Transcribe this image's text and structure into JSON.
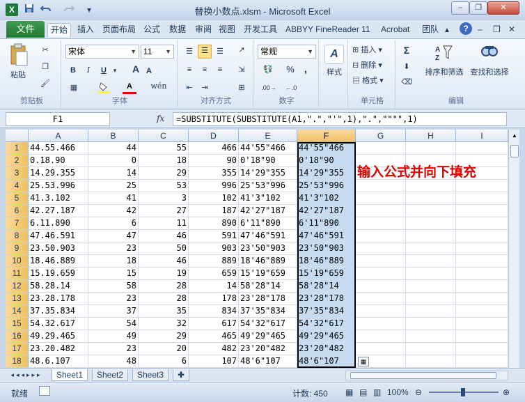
{
  "window": {
    "title": "替换小数点.xlsm - Microsoft Excel"
  },
  "quick_access": {
    "logo": "X",
    "save_icon": "save-icon",
    "undo_icon": "undo-icon",
    "redo_icon": "redo-icon"
  },
  "window_controls": {
    "minimize": "–",
    "restore": "❐",
    "close": "✕",
    "ribbon_min": "–",
    "ribbon_restore": "❐",
    "ribbon_close": "✕"
  },
  "tabs": [
    "文件",
    "开始",
    "插入",
    "页面布局",
    "公式",
    "数据",
    "审阅",
    "视图",
    "开发工具",
    "ABBYY FineReader 11",
    "Acrobat",
    "团队"
  ],
  "help_label": "?",
  "ribbon": {
    "clipboard": {
      "label": "剪贴板",
      "paste": "粘贴"
    },
    "font": {
      "label": "字体",
      "name": "宋体",
      "size": "11",
      "bold": "B",
      "italic": "I",
      "underline": "U",
      "grow": "A",
      "shrink": "A",
      "color_a": "A",
      "wen": "wén"
    },
    "alignment": {
      "label": "对齐方式"
    },
    "number": {
      "label": "数字",
      "format": "常规",
      "percent": "%",
      "comma": ","
    },
    "styles": {
      "label": "样式"
    },
    "cells": {
      "label": "单元格",
      "insert": "插入",
      "delete": "删除",
      "format": "格式"
    },
    "editing": {
      "label": "编辑",
      "sum": "Σ",
      "sort": "排序和筛选",
      "find": "查找和选择"
    }
  },
  "formula_bar": {
    "name_box": "F1",
    "fx": "fx",
    "formula": "=SUBSTITUTE(SUBSTITUTE(A1,\".\",\"'\",1),\".\",\"\"\"\",1)"
  },
  "columns": [
    "A",
    "B",
    "C",
    "D",
    "E",
    "F",
    "G",
    "H",
    "I"
  ],
  "rows": [
    {
      "n": "1",
      "a": "44.55.466",
      "b": "44",
      "c": "55",
      "d": "466",
      "e": "44'55\"466",
      "f": "44'55\"466"
    },
    {
      "n": "2",
      "a": "0.18.90",
      "b": "0",
      "c": "18",
      "d": "90",
      "e": "0'18\"90",
      "f": "0'18\"90"
    },
    {
      "n": "3",
      "a": "14.29.355",
      "b": "14",
      "c": "29",
      "d": "355",
      "e": "14'29\"355",
      "f": "14'29\"355"
    },
    {
      "n": "4",
      "a": "25.53.996",
      "b": "25",
      "c": "53",
      "d": "996",
      "e": "25'53\"996",
      "f": "25'53\"996"
    },
    {
      "n": "5",
      "a": "41.3.102",
      "b": "41",
      "c": "3",
      "d": "102",
      "e": "41'3\"102",
      "f": "41'3\"102"
    },
    {
      "n": "6",
      "a": "42.27.187",
      "b": "42",
      "c": "27",
      "d": "187",
      "e": "42'27\"187",
      "f": "42'27\"187"
    },
    {
      "n": "7",
      "a": "6.11.890",
      "b": "6",
      "c": "11",
      "d": "890",
      "e": "6'11\"890",
      "f": "6'11\"890"
    },
    {
      "n": "8",
      "a": "47.46.591",
      "b": "47",
      "c": "46",
      "d": "591",
      "e": "47'46\"591",
      "f": "47'46\"591"
    },
    {
      "n": "9",
      "a": "23.50.903",
      "b": "23",
      "c": "50",
      "d": "903",
      "e": "23'50\"903",
      "f": "23'50\"903"
    },
    {
      "n": "10",
      "a": "18.46.889",
      "b": "18",
      "c": "46",
      "d": "889",
      "e": "18'46\"889",
      "f": "18'46\"889"
    },
    {
      "n": "11",
      "a": "15.19.659",
      "b": "15",
      "c": "19",
      "d": "659",
      "e": "15'19\"659",
      "f": "15'19\"659"
    },
    {
      "n": "12",
      "a": "58.28.14",
      "b": "58",
      "c": "28",
      "d": "14",
      "e": "58'28\"14",
      "f": "58'28\"14"
    },
    {
      "n": "13",
      "a": "23.28.178",
      "b": "23",
      "c": "28",
      "d": "178",
      "e": "23'28\"178",
      "f": "23'28\"178"
    },
    {
      "n": "14",
      "a": "37.35.834",
      "b": "37",
      "c": "35",
      "d": "834",
      "e": "37'35\"834",
      "f": "37'35\"834"
    },
    {
      "n": "15",
      "a": "54.32.617",
      "b": "54",
      "c": "32",
      "d": "617",
      "e": "54'32\"617",
      "f": "54'32\"617"
    },
    {
      "n": "16",
      "a": "49.29.465",
      "b": "49",
      "c": "29",
      "d": "465",
      "e": "49'29\"465",
      "f": "49'29\"465"
    },
    {
      "n": "17",
      "a": "23.20.482",
      "b": "23",
      "c": "20",
      "d": "482",
      "e": "23'20\"482",
      "f": "23'20\"482"
    },
    {
      "n": "18",
      "a": "48.6.107",
      "b": "48",
      "c": "6",
      "d": "107",
      "e": "48'6\"107",
      "f": "48'6\"107"
    }
  ],
  "annotation": "输入公式并向下填充",
  "sheets": [
    "Sheet1",
    "Sheet2",
    "Sheet3"
  ],
  "status": {
    "ready": "就绪",
    "count": "计数: 450",
    "zoom": "100%"
  },
  "colors": {
    "accent": "#1f7a34",
    "selection": "#c6dcf3",
    "annotation": "#e00000"
  }
}
